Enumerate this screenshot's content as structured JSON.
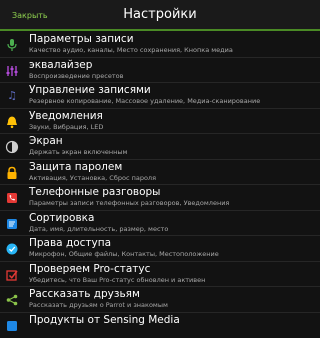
{
  "header": {
    "close_label": "Закрыть",
    "title": "Настройки",
    "accent_color": "#8fd14f"
  },
  "items": [
    {
      "label": "Параметры записи",
      "sub": "Качество аудио, каналы, Место сохранения, Кнопка медиа",
      "icon": "microphone-icon",
      "color": "#4caf50"
    },
    {
      "label": "эквалайзер",
      "sub": "Воспроизведение пресетов",
      "icon": "equalizer-icon",
      "color": "#9c27b0"
    },
    {
      "label": "Управление записями",
      "sub": "Резервное копирование, Массовое удаление, Медиа-сканирование",
      "icon": "music-note-icon",
      "color": "#3f51b5"
    },
    {
      "label": "Уведомления",
      "sub": "Звуки, Вибрация, LED",
      "icon": "bell-icon",
      "color": "#ffc107"
    },
    {
      "label": "Экран",
      "sub": "Держать экран включенным",
      "icon": "brightness-icon",
      "color": "#cfcfcf"
    },
    {
      "label": "Защита паролем",
      "sub": "Активация, Установка, Сброс пароля",
      "icon": "lock-icon",
      "color": "#ffb300"
    },
    {
      "label": "Телефонные разговоры",
      "sub": "Параметры записи телефонных разговоров, Уведомления",
      "icon": "phone-icon",
      "color": "#e53935"
    },
    {
      "label": "Сортировка",
      "sub": "Дата, имя, длительность, размер, место",
      "icon": "sort-icon",
      "color": "#1e88e5"
    },
    {
      "label": "Права доступа",
      "sub": "Микрофон, Общие файлы, Контакты, Местоположение",
      "icon": "permissions-icon",
      "color": "#29b6f6"
    },
    {
      "label": "Проверяем Pro-статус",
      "sub": "Убедитесь, что Ваш Pro-статус обновлен и активен",
      "icon": "checkbox-icon",
      "color": "#e53935"
    },
    {
      "label": "Рассказать друзьям",
      "sub": "Рассказать друзьям о Parrot и знакомым",
      "icon": "share-icon",
      "color": "#8bc34a"
    },
    {
      "label": "Продукты от Sensing Media",
      "sub": "",
      "icon": "apps-icon",
      "color": "#1e88e5"
    }
  ]
}
